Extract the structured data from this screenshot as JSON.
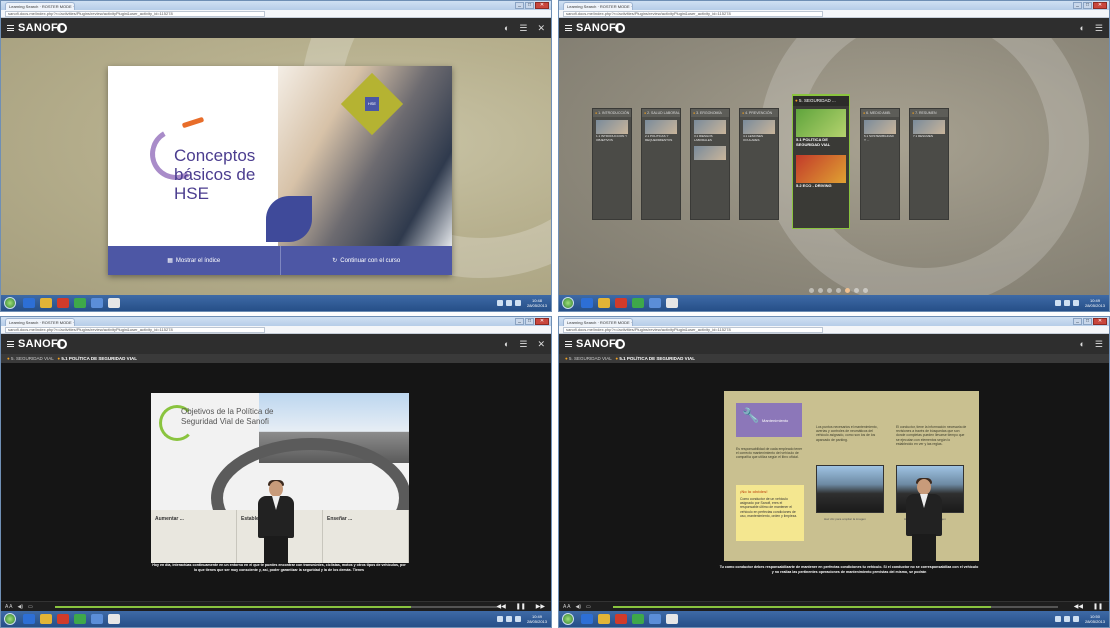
{
  "windows": [
    {
      "tab_title": "Learning Search · ROSTER MODE · Google Chrome",
      "url": "sanofi.docs.me/index.php?r=/activities/Plugins/review/activityPlugin&user_activity_id=115278",
      "brand": "SANOFI",
      "course_title": "Conceptos básicos de HSE",
      "badge": "HSE",
      "buttons": {
        "index": "Mostrar el índice",
        "continue": "Continuar con el curso"
      },
      "clock": {
        "time": "10:48",
        "date": "28/05/2013"
      }
    },
    {
      "tab_title": "Learning Search · ROSTER MODE · Google Chrome",
      "url": "sanofi.docs.me/index.php?r=/activities/Plugins/review/activityPlugin&user_activity_id=115278",
      "brand": "SANOFI",
      "modules": [
        {
          "head": "1. INTRODUCCIÓN",
          "caption": "1.1 INTRODUCCIÓN Y OBJETIVOS"
        },
        {
          "head": "2. SALUD LABORAL",
          "caption": "2.1 POLÍTICAS Y REQUERIMIENTOS"
        },
        {
          "head": "3. ERGONOMÍA",
          "caption": "3.1 RIESGOS LABORALES"
        },
        {
          "head": "4. PREVENCIÓN",
          "caption": "4.1 LESIONES OCULARES"
        },
        {
          "head": "5. SEGURIDAD ...",
          "caption": "5.1 POLÍTICA DE SEGURIDAD VIAL",
          "caption2": "5.2 ECO - DRIVING"
        },
        {
          "head": "6. MEDIO AMB.",
          "caption": "6.1 SOSTENIBILIDAD Y ..."
        },
        {
          "head": "7. RESUMEN",
          "caption": "7.1 RESUMEN"
        }
      ],
      "clock": {
        "time": "10:49",
        "date": "28/05/2013"
      }
    },
    {
      "tab_title": "Learning Search · ROSTER MODE · Google Chrome",
      "url": "sanofi.docs.me/index.php?r=/activities/Plugins/review/activityPlugin&user_activity_id=115278",
      "brand": "SANOFI",
      "crumb_parent": "5. SEGURIDAD VIAL",
      "crumb_current": "5.1 POLÍTICA DE SEGURIDAD VIAL",
      "slide_title": "Objetivos de la Política de Seguridad Vial de Sanofi",
      "cells": [
        "Aumentar ...",
        "Establecer ...",
        "Enseñar ..."
      ],
      "subtitle": "Hoy en día, interactúas continuamente en un entorno en el que te puedes encontrar con transeúntes, ciclistas, motos y otros tipos de vehículos, por lo que tienes que ser muy consciente y, así, poder garantizar la seguridad y la de los demás. Tienes",
      "clock": {
        "time": "10:49",
        "date": "28/05/2013"
      }
    },
    {
      "tab_title": "Learning Search · ROSTER MODE · Google Chrome",
      "url": "sanofi.docs.me/index.php?r=/activities/Plugins/review/activityPlugin&user_activity_id=115278",
      "brand": "SANOFI",
      "crumb_parent": "5. SEGURIDAD VIAL",
      "crumb_current": "5.1 POLÍTICA DE SEGURIDAD VIAL",
      "section_label": "Mantenimiento",
      "text_left": "Es responsabilidad de cada empleado tener el correcto mantenimiento del vehículo de compañía que utiliza según el libro oficial.",
      "text_mid": "Los puntos necesarios el mantenimiento, averías y controles de neumáticos del vehículo asignado, como son los de los aparcado de parking.",
      "text_right": "El conductor, tiene la información necesaria de revisiones a través de búsquedas que son donde completas pueden llevarse tiempo que se ejecutan con elementos según lo establecido en ver y las reglas.",
      "note_title": "¡No lo olvides!",
      "note_text": "Como conductor de un vehículo asignado por Sanofi, eres el responsable último de mantener el vehículo en perfectas condiciones de uso, mantenimiento, orden y limpieza.",
      "caption_left": "Haz clic para ampliar la imagen",
      "caption_right": "Haz clic para ampliar la imagen",
      "subtitle": "Tu como conductor debes responsabilizarte de mantener en perfectas condiciones tu vehículo. Si el conductor no se corresponsabiliza con el vehículo y no realiza las pertinentes operaciones de mantenimiento previstas del mismo, se podrán",
      "clock": {
        "time": "10:50",
        "date": "28/05/2013"
      }
    }
  ]
}
